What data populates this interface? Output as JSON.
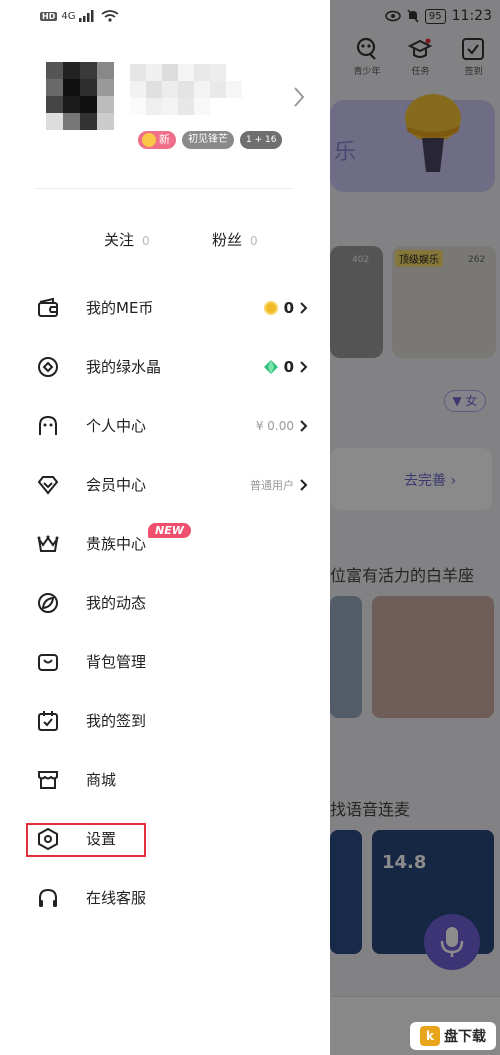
{
  "status_bar": {
    "left_hd": "HD",
    "left_network": "4G",
    "right_battery": "95",
    "right_time": "11:23"
  },
  "background_app": {
    "top_icons": [
      {
        "icon": "teen-icon",
        "label": "青少年"
      },
      {
        "icon": "mission-icon",
        "label": "任务"
      },
      {
        "icon": "sign-in-icon",
        "label": "签到"
      }
    ],
    "banner_text": "乐",
    "card_tag": "顶级娱乐",
    "card_counts": [
      "402",
      "262"
    ],
    "filter_label": "女",
    "complete_label": "去完善",
    "section_title_1": "位富有活力的白羊座",
    "section_title_2": "找语音连麦",
    "photo_number": "14.8"
  },
  "profile": {
    "badges": [
      {
        "type": "new",
        "label": "新"
      },
      {
        "type": "gray",
        "label": "初见锋芒"
      },
      {
        "type": "level",
        "label": "1 + 16"
      }
    ]
  },
  "follow_stats": [
    {
      "label": "关注",
      "value": "0"
    },
    {
      "label": "粉丝",
      "value": "0"
    }
  ],
  "menu": [
    {
      "key": "me-coin",
      "icon": "wallet-icon",
      "label": "我的ME币",
      "value": "0",
      "value_type": "coin"
    },
    {
      "key": "green-crystal",
      "icon": "crystal-icon",
      "label": "我的绿水晶",
      "value": "0",
      "value_type": "gem"
    },
    {
      "key": "personal-center",
      "icon": "person-icon",
      "label": "个人中心",
      "value": "¥ 0.00",
      "value_type": "text"
    },
    {
      "key": "member-center",
      "icon": "diamond-icon",
      "label": "会员中心",
      "value": "普通用户",
      "value_type": "text"
    },
    {
      "key": "noble-center",
      "icon": "crown-icon",
      "label": "贵族中心",
      "tag": "NEW"
    },
    {
      "key": "my-posts",
      "icon": "leaf-icon",
      "label": "我的动态"
    },
    {
      "key": "backpack",
      "icon": "bag-icon",
      "label": "背包管理"
    },
    {
      "key": "my-checkin",
      "icon": "calendar-check-icon",
      "label": "我的签到"
    },
    {
      "key": "mall",
      "icon": "store-icon",
      "label": "商城"
    },
    {
      "key": "settings",
      "icon": "settings-hex-icon",
      "label": "设置"
    },
    {
      "key": "customer-service",
      "icon": "headphones-icon",
      "label": "在线客服"
    }
  ],
  "watermark": {
    "text": "盘下载",
    "mark": "k"
  },
  "colors": {
    "highlight_border": "#e0303a",
    "new_tag": "#f0506e",
    "gem": "#2fc27a",
    "coin": "#f0b928",
    "accent": "#6c67c9"
  }
}
